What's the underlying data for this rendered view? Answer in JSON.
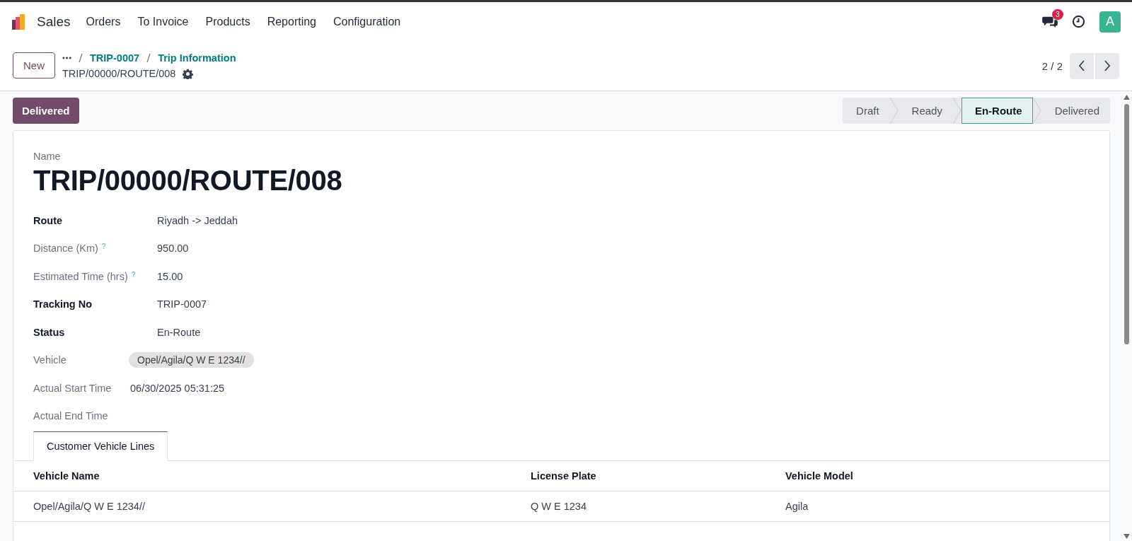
{
  "navbar": {
    "app_name": "Sales",
    "menu": [
      "Orders",
      "To Invoice",
      "Products",
      "Reporting",
      "Configuration"
    ],
    "messages_badge": "3",
    "avatar_letter": "A"
  },
  "control_panel": {
    "new_button": "New",
    "breadcrumbs": [
      "TRIP-0007",
      "Trip Information"
    ],
    "record_name": "TRIP/00000/ROUTE/008",
    "pager": "2 / 2"
  },
  "action_button": "Delivered",
  "stages": [
    {
      "label": "Draft",
      "selected": false
    },
    {
      "label": "Ready",
      "selected": false
    },
    {
      "label": "En-Route",
      "selected": true
    },
    {
      "label": "Delivered",
      "selected": false
    }
  ],
  "form": {
    "name_label": "Name",
    "name": "TRIP/00000/ROUTE/008",
    "fields": [
      {
        "label": "Route",
        "value": "Riyadh -> Jeddah",
        "required": true,
        "kind": "text"
      },
      {
        "label": "Distance (Km)",
        "help": "?",
        "value": "950.00",
        "required": false,
        "kind": "text"
      },
      {
        "label": "Estimated Time (hrs)",
        "help": "?",
        "value": "15.00",
        "required": false,
        "kind": "text"
      },
      {
        "label": "Tracking No",
        "value": "TRIP-0007",
        "required": true,
        "kind": "text"
      },
      {
        "label": "Status",
        "value": "En-Route",
        "required": true,
        "kind": "text"
      },
      {
        "label": "Vehicle",
        "value": "Opel/Agila/Q W E 1234//",
        "required": false,
        "kind": "tag"
      },
      {
        "label": "Actual Start Time",
        "value": "06/30/2025 05:31:25",
        "required": false,
        "kind": "date"
      },
      {
        "label": "Actual End Time",
        "required": false
      }
    ]
  },
  "notebook": {
    "tabs": [
      {
        "label": "Customer Vehicle Lines",
        "selected": true
      }
    ],
    "table": {
      "columns": [
        "Vehicle Name",
        "License Plate",
        "Vehicle Model"
      ],
      "rows": [
        [
          "Opel/Agila/Q W E 1234//",
          "Q W E 1234",
          "Agila"
        ]
      ]
    }
  }
}
